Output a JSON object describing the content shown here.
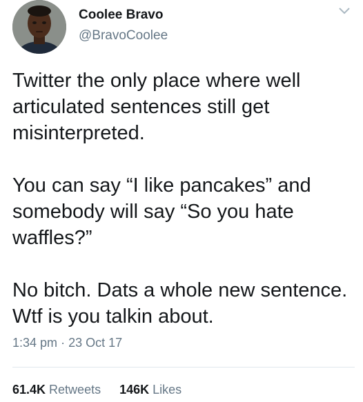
{
  "user": {
    "display_name": "Coolee Bravo",
    "handle": "@BravoCoolee"
  },
  "tweet": {
    "paragraphs": [
      "Twitter the only place where well articulated sentences still get misinterpreted.",
      "You can say “I like pancakes” and somebody will say “So you hate waffles?”",
      "No bitch. Dats a whole new sentence. Wtf is you talkin about."
    ],
    "time": "1:34 pm",
    "separator": "·",
    "date": "23 Oct 17"
  },
  "stats": {
    "retweets_count": "61.4K",
    "retweets_label": "Retweets",
    "likes_count": "146K",
    "likes_label": "Likes"
  },
  "icons": {
    "menu": "chevron-down-icon"
  },
  "colors": {
    "text": "#14171a",
    "secondary": "#657786",
    "divider": "#e1e8ed"
  }
}
